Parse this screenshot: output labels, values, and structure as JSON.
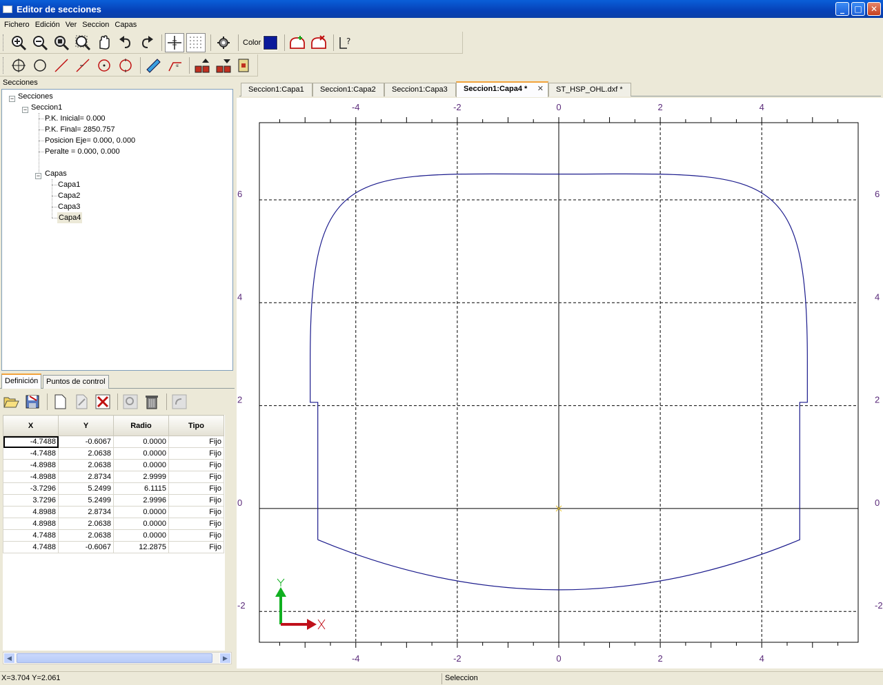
{
  "window": {
    "title": "Editor de secciones",
    "min": "_",
    "max": "□",
    "close": "✕"
  },
  "menu": [
    "Fichero",
    "Edición",
    "Ver",
    "Seccion",
    "Capas"
  ],
  "toolbar": {
    "color_label": "Color",
    "color_value": "#0a1a9a"
  },
  "secciones_panel": {
    "header": "Secciones",
    "tree": {
      "root": "Secciones",
      "section": "Seccion1",
      "props": [
        "P.K. Inicial= 0.000",
        "P.K. Final= 2850.757",
        "Posicion Eje= 0.000, 0.000",
        "Peralte = 0.000, 0.000"
      ],
      "capas_label": "Capas",
      "capas": [
        "Capa1",
        "Capa2",
        "Capa3",
        "Capa4"
      ],
      "selected": "Capa4"
    }
  },
  "bottom_tabs": [
    "Definición",
    "Puntos de control"
  ],
  "table": {
    "headers": [
      "X",
      "Y",
      "Radio",
      "Tipo"
    ],
    "rows": [
      [
        "-4.7488",
        "-0.6067",
        "0.0000",
        "Fijo"
      ],
      [
        "-4.7488",
        "2.0638",
        "0.0000",
        "Fijo"
      ],
      [
        "-4.8988",
        "2.0638",
        "0.0000",
        "Fijo"
      ],
      [
        "-4.8988",
        "2.8734",
        "2.9999",
        "Fijo"
      ],
      [
        "-3.7296",
        "5.2499",
        "6.1115",
        "Fijo"
      ],
      [
        "3.7296",
        "5.2499",
        "2.9996",
        "Fijo"
      ],
      [
        "4.8988",
        "2.8734",
        "0.0000",
        "Fijo"
      ],
      [
        "4.8988",
        "2.0638",
        "0.0000",
        "Fijo"
      ],
      [
        "4.7488",
        "2.0638",
        "0.0000",
        "Fijo"
      ],
      [
        "4.7488",
        "-0.6067",
        "12.2875",
        "Fijo"
      ]
    ]
  },
  "doc_tabs": [
    {
      "label": "Seccion1:Capa1",
      "active": false
    },
    {
      "label": "Seccion1:Capa2",
      "active": false
    },
    {
      "label": "Seccion1:Capa3",
      "active": false
    },
    {
      "label": "Seccion1:Capa4 *",
      "active": true
    },
    {
      "label": "ST_HSP_OHL.dxf *",
      "active": false
    }
  ],
  "doc_tab_close": "✕",
  "drawing": {
    "x_range": [
      -5.9,
      5.9
    ],
    "y_range": [
      -2.6,
      7.5
    ],
    "x_ticks": [
      -4,
      -2,
      0,
      2,
      4
    ],
    "y_ticks": [
      -2,
      0,
      2,
      4,
      6
    ],
    "line_color": "#1a1a8c",
    "axis_label_color": "#5a2a7a",
    "profile": {
      "straight_bottom_left": [
        -4.7488,
        -0.6067
      ],
      "straight_top_left": [
        -4.7488,
        2.0638
      ],
      "step_left": [
        -4.8988,
        2.0638
      ],
      "arc_start_left": [
        -4.8988,
        2.8734
      ],
      "crown_left": [
        -3.7296,
        5.2499
      ],
      "crown_right": [
        3.7296,
        5.2499
      ],
      "arc_end_right": [
        4.8988,
        2.8734
      ],
      "step_right": [
        4.8988,
        2.0638
      ],
      "straight_top_right": [
        4.7488,
        2.0638
      ],
      "straight_bottom_right": [
        4.7488,
        -0.6067
      ],
      "crown_top_y": 6.5,
      "invert_bottom_y": -1.58
    },
    "origin_marker": {
      "x_axis_color": "#c0101a",
      "y_axis_color": "#10b020"
    }
  },
  "status": {
    "coords": "X=3.704 Y=2.061",
    "mode": "Seleccion"
  }
}
